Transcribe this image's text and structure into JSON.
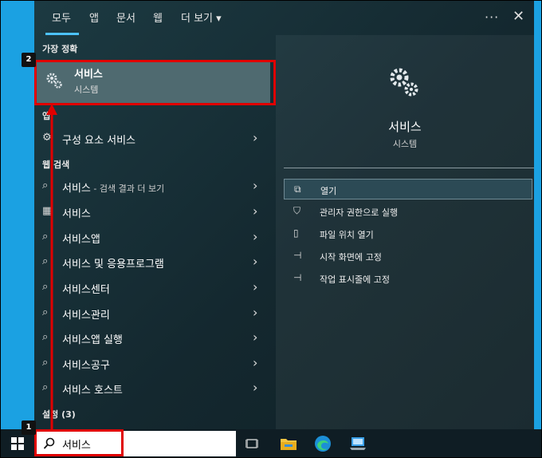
{
  "tabs": [
    "모두",
    "앱",
    "문서",
    "웹",
    "더 보기 ▾"
  ],
  "more_label": "···",
  "close_label": "✕",
  "best_match_header": "가장 정확",
  "best_match": {
    "title": "서비스",
    "subtitle": "시스템"
  },
  "apps_header": "앱",
  "apps": [
    {
      "label": "구성 요소 서비스",
      "icon": "component-services-icon"
    }
  ],
  "web_header": "웹 검색",
  "web_results": [
    {
      "label": "서비스",
      "sub": " - 검색 결과 더 보기",
      "icon": "search-icon"
    },
    {
      "label": "서비스",
      "sub": "",
      "icon": "web-thumbnail-icon"
    },
    {
      "label": "서비스앱",
      "sub": "",
      "icon": "search-icon"
    },
    {
      "label": "서비스 및 응용프로그램",
      "sub": "",
      "icon": "search-icon"
    },
    {
      "label": "서비스센터",
      "sub": "",
      "icon": "search-icon"
    },
    {
      "label": "서비스관리",
      "sub": "",
      "icon": "search-icon"
    },
    {
      "label": "서비스앱 실행",
      "sub": "",
      "icon": "search-icon"
    },
    {
      "label": "서비스공구",
      "sub": "",
      "icon": "search-icon"
    },
    {
      "label": "서비스 호스트",
      "sub": "",
      "icon": "search-icon"
    }
  ],
  "settings_header": "설정 (3)",
  "detail": {
    "title": "서비스",
    "subtitle": "시스템"
  },
  "actions": [
    {
      "label": "열기",
      "icon": "open-icon"
    },
    {
      "label": "관리자 권한으로 실행",
      "icon": "shield-icon"
    },
    {
      "label": "파일 위치 열기",
      "icon": "file-location-icon"
    },
    {
      "label": "시작 화면에 고정",
      "icon": "pin-icon"
    },
    {
      "label": "작업 표시줄에 고정",
      "icon": "pin-icon"
    }
  ],
  "search": {
    "value": "서비스"
  },
  "badges": {
    "one": "1",
    "two": "2"
  },
  "colors": {
    "accent": "#4cc2ff",
    "highlight": "#e00000",
    "desktop": "#1ba1e2"
  }
}
